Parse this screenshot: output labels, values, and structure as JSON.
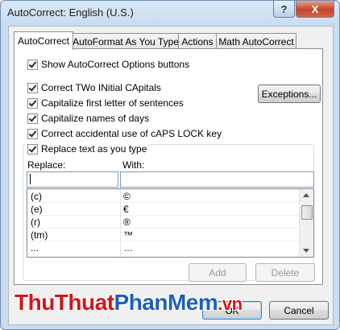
{
  "window": {
    "title": "AutoCorrect: English (U.S.)",
    "help_glyph": "?",
    "close_glyph": "X"
  },
  "tabs": [
    {
      "label": "AutoCorrect",
      "active": true
    },
    {
      "label": "AutoFormat As You Type",
      "active": false
    },
    {
      "label": "Actions",
      "active": false
    },
    {
      "label": "Math AutoCorrect",
      "active": false
    }
  ],
  "options": {
    "show_buttons": {
      "label": "Show AutoCorrect Options buttons",
      "checked": true
    },
    "two_initial_caps": {
      "label": "Correct TWo INitial CApitals",
      "checked": true
    },
    "capitalize_first": {
      "label": "Capitalize first letter of sentences",
      "checked": true
    },
    "capitalize_days": {
      "label": "Capitalize names of days",
      "checked": true
    },
    "caps_lock": {
      "label": "Correct accidental use of cAPS LOCK key",
      "checked": true
    },
    "replace_text": {
      "label": "Replace text as you type",
      "checked": true
    }
  },
  "exceptions_button": "Exceptions...",
  "replace": {
    "replace_label": "Replace:",
    "with_label": "With:",
    "replace_value": "",
    "with_value": "",
    "entries": [
      {
        "replace": "(c)",
        "with": "©"
      },
      {
        "replace": "(e)",
        "with": "€"
      },
      {
        "replace": "(r)",
        "with": "®"
      },
      {
        "replace": "(tm)",
        "with": "™"
      },
      {
        "replace": "...",
        "with": "…"
      }
    ]
  },
  "buttons": {
    "add": "Add",
    "delete": "Delete",
    "ok": "OK",
    "cancel": "Cancel"
  },
  "watermark": {
    "part1": "ThuThuat",
    "part2": "PhanMem",
    "part3": ".vn"
  }
}
